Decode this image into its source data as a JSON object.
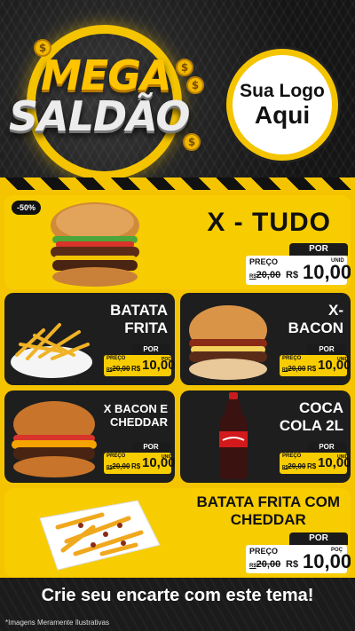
{
  "header": {
    "title_line1": "MEGA",
    "title_line2": "SALDÃO",
    "coin_symbol": "$",
    "logo_line1": "Sua Logo",
    "logo_line2": "Aqui"
  },
  "colors": {
    "accent": "#f5c400",
    "dark": "#1b1b1b",
    "white": "#ffffff"
  },
  "products": {
    "xtudo": {
      "name": "X - TUDO",
      "badge": "-50%",
      "por": "POR",
      "label": "PREÇO",
      "old": "20,00",
      "old_prefix": "R$",
      "rs": "R$",
      "price": "10,00",
      "unit": "UNID"
    },
    "batata": {
      "name1": "BATATA",
      "name2": "FRITA",
      "por": "POR",
      "label": "PREÇO",
      "old": "20,00",
      "old_prefix": "R$",
      "rs": "R$",
      "price": "10,00",
      "unit": "POÇ"
    },
    "xbacon": {
      "name1": "X-",
      "name2": "BACON",
      "por": "POR",
      "label": "PREÇO",
      "old": "20,00",
      "old_prefix": "R$",
      "rs": "R$",
      "price": "10,00",
      "unit": "UNID"
    },
    "xbaconcheddar": {
      "name1": "X BACON E",
      "name2": "CHEDDAR",
      "por": "POR",
      "label": "PREÇO",
      "old": "20,00",
      "old_prefix": "R$",
      "rs": "R$",
      "price": "10,00",
      "unit": "UNID"
    },
    "coca": {
      "name1": "COCA",
      "name2": "COLA 2L",
      "por": "POR",
      "label": "PREÇO",
      "old": "20,00",
      "old_prefix": "R$",
      "rs": "R$",
      "price": "10,00",
      "unit": "UNID"
    },
    "batatacheddar": {
      "name1": "BATATA FRITA COM",
      "name2": "CHEDDAR",
      "por": "POR",
      "label": "PREÇO",
      "old": "20,00",
      "old_prefix": "R$",
      "rs": "R$",
      "price": "10,00",
      "unit": "POÇ"
    }
  },
  "footer": {
    "cta": "Crie seu encarte com este tema!",
    "disclaimer": "*Imagens Meramente Ilustrativas"
  }
}
